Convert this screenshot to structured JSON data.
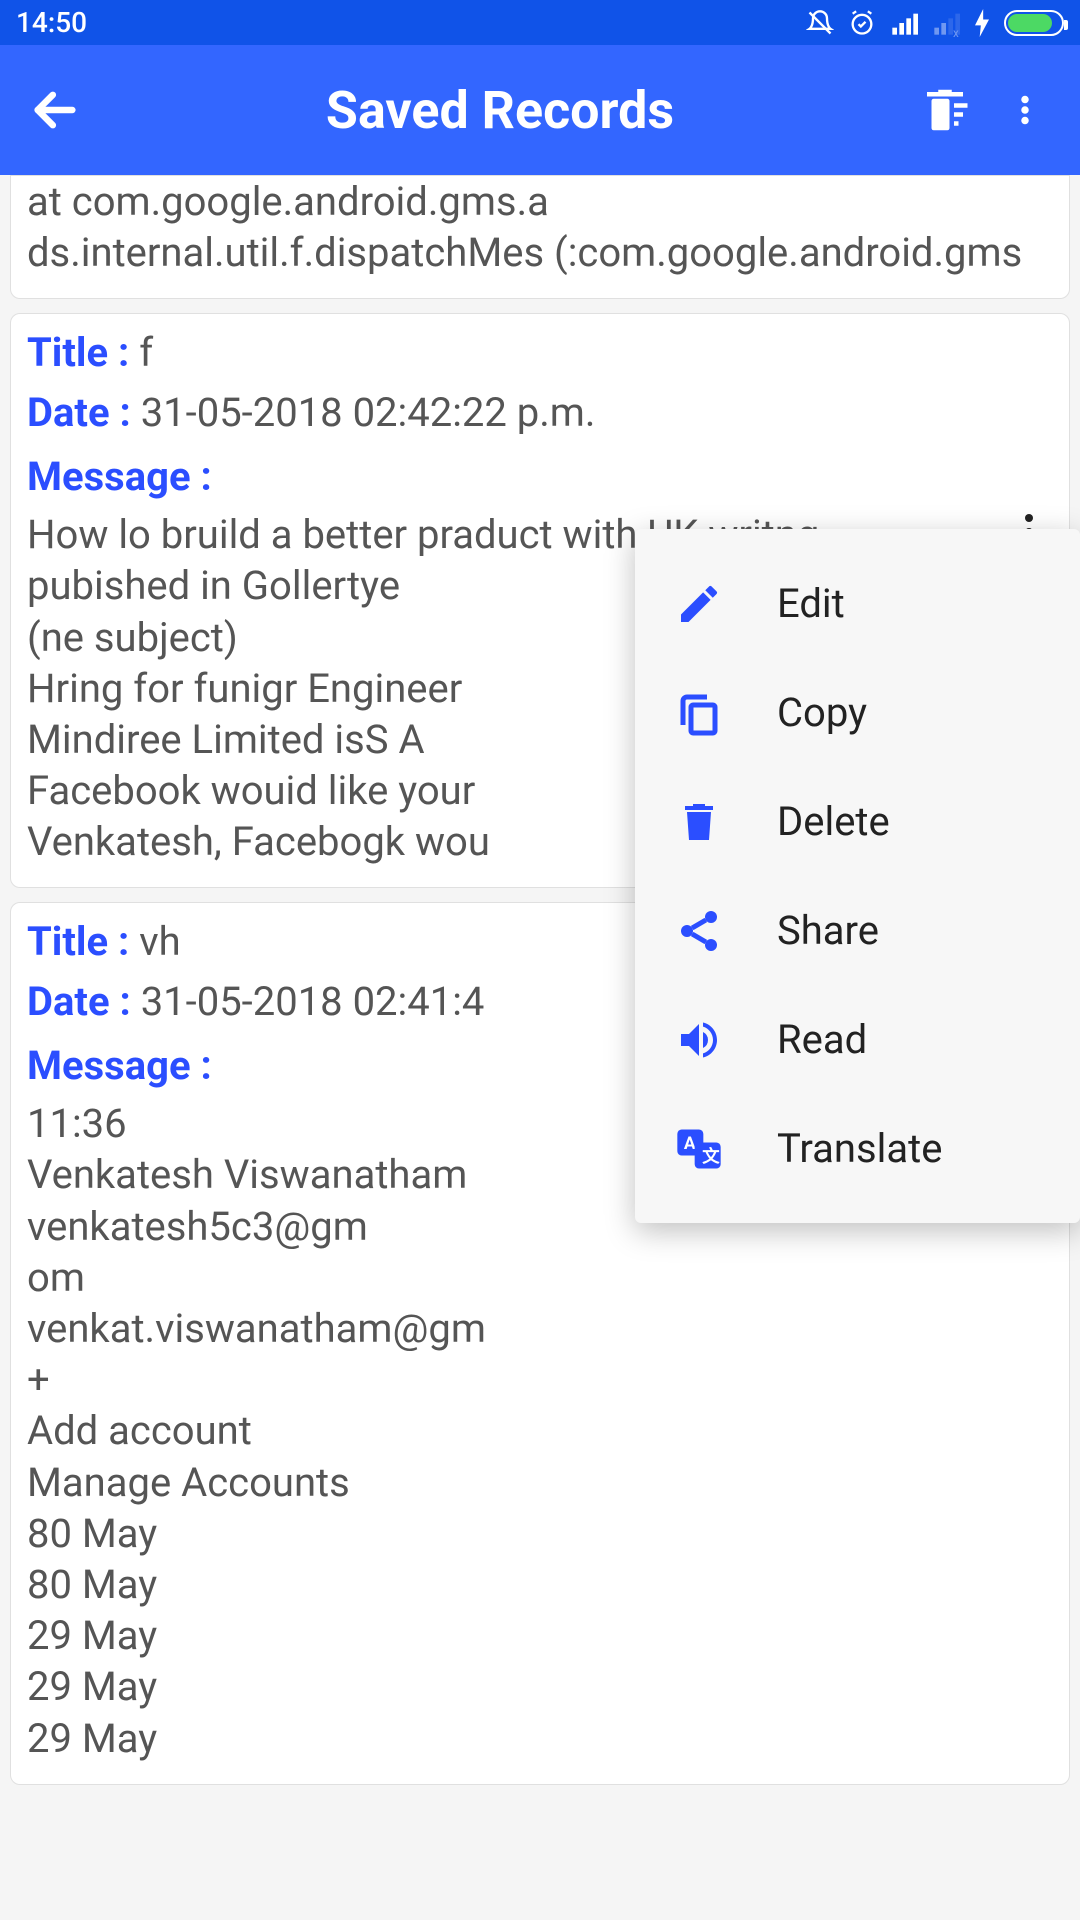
{
  "status": {
    "time": "14:50"
  },
  "header": {
    "title": "Saved Records"
  },
  "records": {
    "partial_top": "at com.google.android.gms.a\nds.internal.util.f.dispatchMes\n(:com.google.android.gms",
    "r1": {
      "title_label": "Title : ",
      "title_value": "f",
      "date_label": "Date : ",
      "date_value": "31-05-2018 02:42:22 p.m.",
      "message_label": "Message :",
      "message_body": "How lo bruild a better praduct with UK writng\npubished in Gollertye\n(ne subject)\nHring for funigr Engineer\nMindiree Limited isS A\nFacebook wouid like your\nVenkatesh, Facebogk wou"
    },
    "r2": {
      "title_label": "Title : ",
      "title_value": "vh",
      "date_label": "Date : ",
      "date_value": "31-05-2018 02:41:4",
      "message_label": "Message :",
      "message_body": "11:36\nVenkatesh Viswanatham\nvenkatesh5c3@gm\nom\nvenkat.viswanatham@gm\n+\nAdd account\nManage Accounts\n80 May\n80 May\n29 May\n29 May\n29 May"
    }
  },
  "popup": {
    "edit": "Edit",
    "copy": "Copy",
    "delete": "Delete",
    "share": "Share",
    "read": "Read",
    "translate": "Translate"
  }
}
